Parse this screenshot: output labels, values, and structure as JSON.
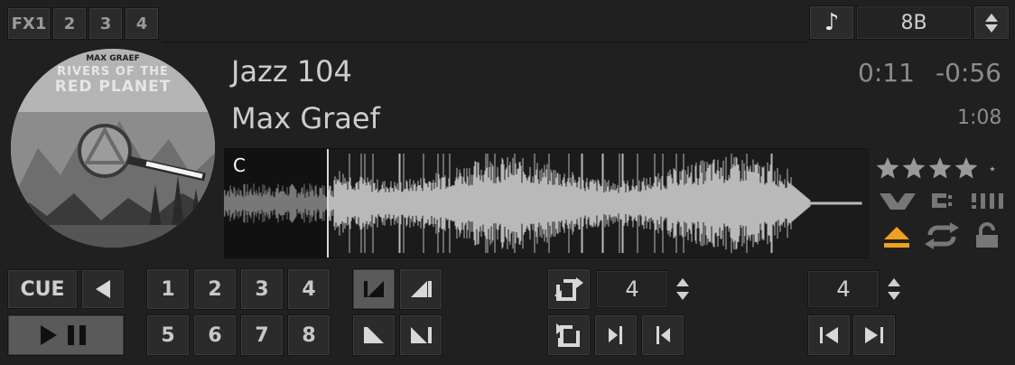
{
  "fx": {
    "buttons": [
      "FX1",
      "2",
      "3",
      "4"
    ]
  },
  "key": {
    "value": "8B"
  },
  "track": {
    "title": "Jazz 104",
    "artist": "Max Graef",
    "elapsed": "0:11",
    "remaining": "-0:56",
    "duration": "1:08"
  },
  "cover_art": {
    "artist_text": "MAX GRAEF",
    "title_line1": "RIVERS OF THE",
    "title_line2": "RED PLANET"
  },
  "waveform": {
    "cue_label": "C",
    "progress": 0.16
  },
  "rating": {
    "stars": 4,
    "max": 5
  },
  "transport": {
    "cue_label": "CUE"
  },
  "hotcues": [
    "1",
    "2",
    "3",
    "4",
    "5",
    "6",
    "7",
    "8"
  ],
  "loop": {
    "size": "4"
  },
  "beatjump": {
    "size": "4"
  },
  "colors": {
    "accent": "#f0a020",
    "background": "#202020",
    "panel": "#2b2b2b"
  }
}
